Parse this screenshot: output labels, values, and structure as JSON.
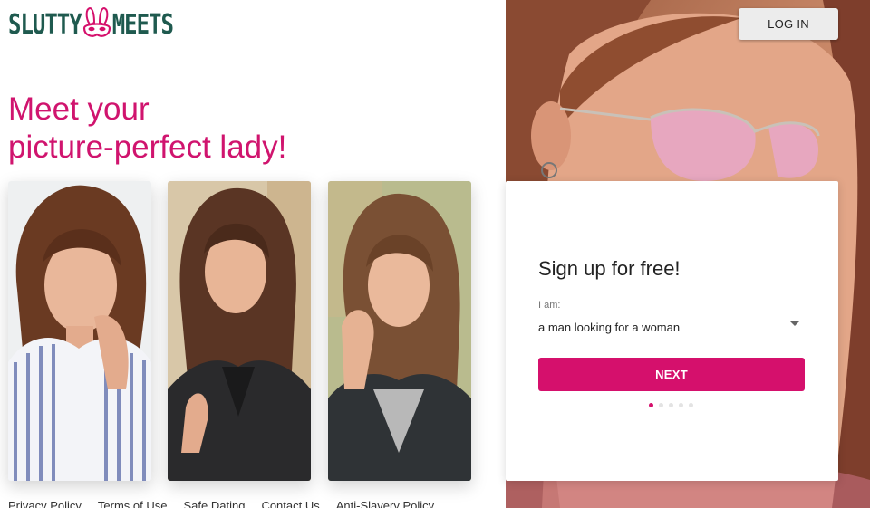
{
  "brand": {
    "name_left": "SLUTTY",
    "name_right": "MEETS"
  },
  "headline": {
    "line1": "Meet your",
    "line2": "picture-perfect lady!"
  },
  "header": {
    "login_label": "LOG IN"
  },
  "signup": {
    "title": "Sign up for free!",
    "field_label": "I am:",
    "selected_value": "a man looking for a woman",
    "next_label": "NEXT",
    "steps_total": 5,
    "steps_current": 1
  },
  "footer": {
    "links": [
      "Privacy Policy",
      "Terms of Use",
      "Safe Dating",
      "Contact Us",
      "Anti-Slavery Policy"
    ]
  },
  "colors": {
    "accent": "#d5106c",
    "logo": "#1f5a4f"
  }
}
